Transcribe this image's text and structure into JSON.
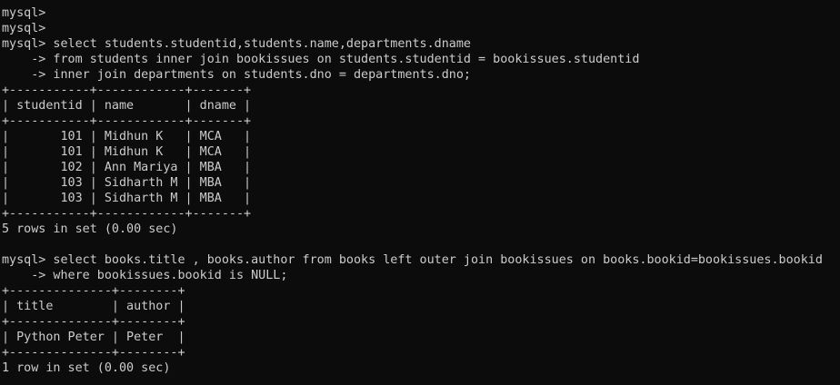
{
  "terminal": {
    "lines": [
      "mysql>",
      "mysql>",
      "mysql> select students.studentid,students.name,departments.dname",
      "    -> from students inner join bookissues on students.studentid = bookissues.studentid",
      "    -> inner join departments on students.dno = departments.dno;",
      "+-----------+------------+-------+",
      "| studentid | name       | dname |",
      "+-----------+------------+-------+",
      "|       101 | Midhun K   | MCA   |",
      "|       101 | Midhun K   | MCA   |",
      "|       102 | Ann Mariya | MBA   |",
      "|       103 | Sidharth M | MBA   |",
      "|       103 | Sidharth M | MBA   |",
      "+-----------+------------+-------+",
      "5 rows in set (0.00 sec)",
      "",
      "mysql> select books.title , books.author from books left outer join bookissues on books.bookid=bookissues.bookid",
      "    -> where bookissues.bookid is NULL;",
      "+--------------+--------+",
      "| title        | author |",
      "+--------------+--------+",
      "| Python Peter | Peter  |",
      "+--------------+--------+",
      "1 row in set (0.00 sec)"
    ]
  }
}
